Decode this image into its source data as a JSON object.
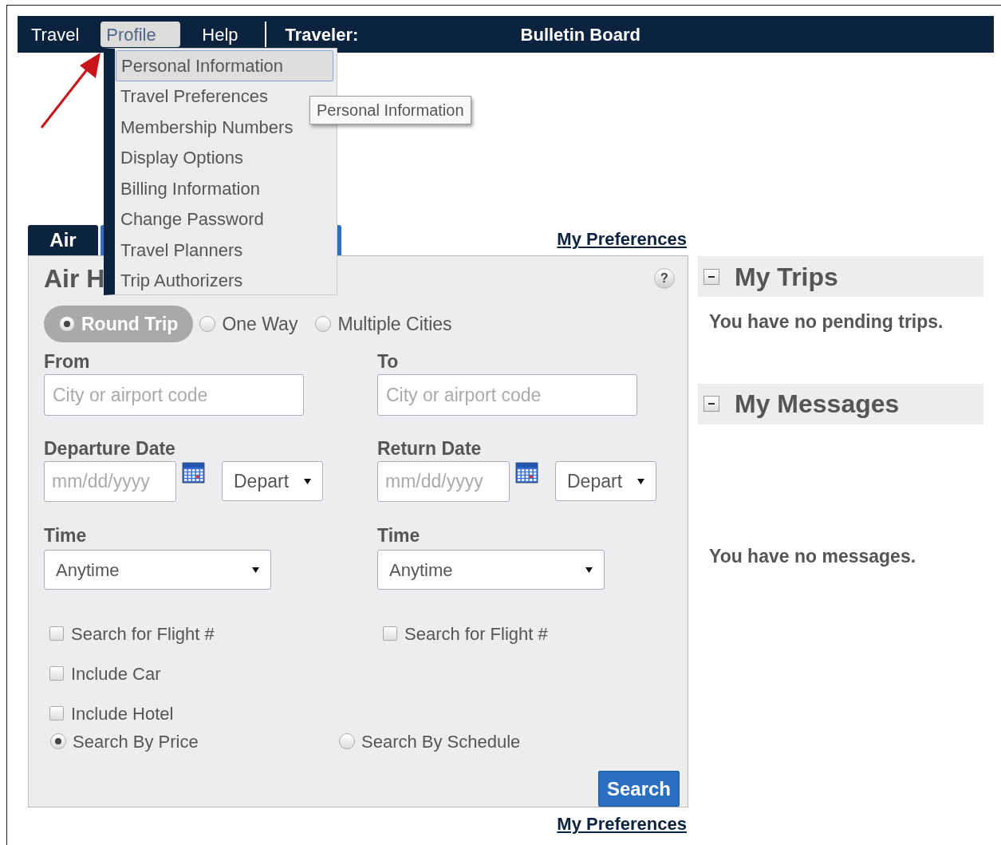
{
  "nav": {
    "items": [
      {
        "label": "Travel",
        "selected": false
      },
      {
        "label": "Profile",
        "selected": true
      },
      {
        "label": "Help",
        "selected": false
      }
    ],
    "traveler_label": "Traveler:",
    "title": "Bulletin Board"
  },
  "profile_menu": {
    "items": [
      {
        "label": "Personal Information",
        "selected": true
      },
      {
        "label": "Travel Preferences",
        "selected": false
      },
      {
        "label": "Membership Numbers",
        "selected": false
      },
      {
        "label": "Display Options",
        "selected": false
      },
      {
        "label": "Billing Information",
        "selected": false
      },
      {
        "label": "Change Password",
        "selected": false
      },
      {
        "label": "Travel Planners",
        "selected": false
      },
      {
        "label": "Trip Authorizers",
        "selected": false
      }
    ],
    "tooltip": "Personal Information"
  },
  "tabs": [
    {
      "label": "Air",
      "selected": true
    },
    {
      "selected": false
    }
  ],
  "preferences_link_top": "My Preferences",
  "air_panel": {
    "title": "Air H",
    "help": "?",
    "trip_types": [
      {
        "label": "Round Trip",
        "selected": true
      },
      {
        "label": "One Way",
        "selected": false
      },
      {
        "label": "Multiple Cities",
        "selected": false
      }
    ],
    "legs": [
      {
        "place_label": "From",
        "place_placeholder": "City or airport code",
        "date_label": "Departure Date",
        "date_placeholder": "mm/dd/yyyy",
        "date_select": "Depart",
        "time_label": "Time",
        "time": "Anytime",
        "options": [
          {
            "label": "Search for Flight #",
            "checked": false
          },
          {
            "label": "Include Car",
            "checked": false
          },
          {
            "label": "Include Hotel",
            "checked": false
          }
        ]
      },
      {
        "place_label": "To",
        "place_placeholder": "City or airport code",
        "date_label": "Return Date",
        "date_placeholder": "mm/dd/yyyy",
        "date_select": "Depart",
        "time_label": "Time",
        "time": "Anytime",
        "options": [
          {
            "label": "Search for Flight #",
            "checked": false
          }
        ]
      }
    ],
    "search_modes": [
      {
        "label": "Search By Price",
        "selected": true
      },
      {
        "label": "Search By Schedule",
        "selected": false
      }
    ],
    "search_button": "Search"
  },
  "preferences_link_bottom": "My Preferences",
  "sidebar": [
    {
      "title": "My Trips",
      "expanded": true,
      "message": "You have no pending trips."
    },
    {
      "title": "My Messages",
      "expanded": true,
      "message": "You have no messages."
    }
  ]
}
